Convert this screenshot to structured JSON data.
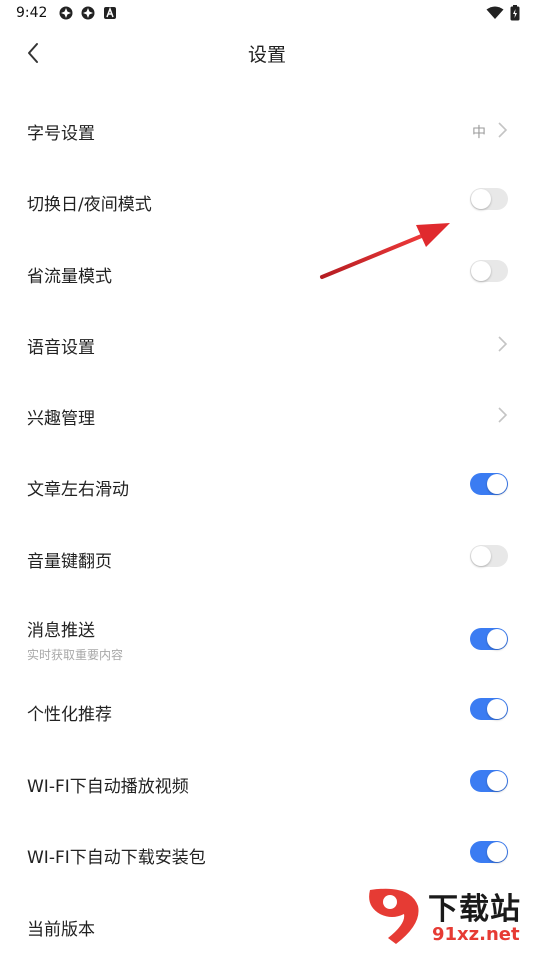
{
  "status_bar": {
    "time": "9:42",
    "left_icons": [
      "settings-gear-icon",
      "settings-gear-icon",
      "app-a-icon"
    ],
    "right_icons": [
      "wifi-icon",
      "battery-icon"
    ]
  },
  "header": {
    "title": "设置",
    "back_icon": "chevron-left-icon"
  },
  "settings": [
    {
      "label": "字号设置",
      "control": "chevron",
      "value": "中"
    },
    {
      "label": "切换日/夜间模式",
      "control": "toggle",
      "on": false
    },
    {
      "label": "省流量模式",
      "control": "toggle",
      "on": false
    },
    {
      "label": "语音设置",
      "control": "chevron"
    },
    {
      "label": "兴趣管理",
      "control": "chevron"
    },
    {
      "label": "文章左右滑动",
      "control": "toggle",
      "on": true
    },
    {
      "label": "音量键翻页",
      "control": "toggle",
      "on": false
    },
    {
      "label": "消息推送",
      "subtitle": "实时获取重要内容",
      "control": "toggle",
      "on": true
    },
    {
      "label": "个性化推荐",
      "control": "toggle",
      "on": true
    },
    {
      "label": "WI-FI下自动播放视频",
      "control": "toggle",
      "on": true
    },
    {
      "label": "WI-FI下自动下载安装包",
      "control": "toggle",
      "on": true
    },
    {
      "label": "当前版本",
      "control": "none"
    }
  ],
  "colors": {
    "accent": "#3b7cf2",
    "toggle_off": "#e8e8e8",
    "annotation_arrow": "#d9262b"
  },
  "watermark": {
    "brand_top": "下载站",
    "brand_bottom": "91xz.net"
  }
}
